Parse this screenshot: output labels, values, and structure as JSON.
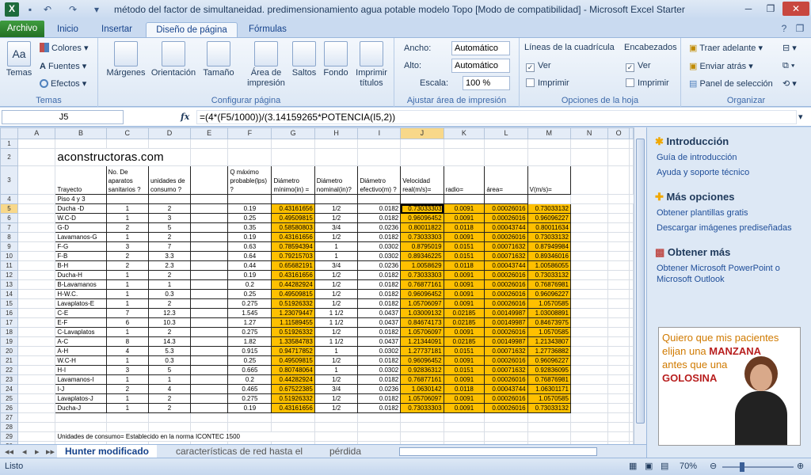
{
  "window": {
    "title": "método del factor de simultaneidad. predimensionamiento agua potable modelo Topo  [Modo de compatibilidad]  -  Microsoft Excel Starter"
  },
  "tabs": [
    "Archivo",
    "Inicio",
    "Insertar",
    "Diseño de página",
    "Fórmulas"
  ],
  "ribbon": {
    "temas": {
      "label": "Temas",
      "colores": "Colores",
      "fuentes": "Fuentes",
      "efectos": "Efectos",
      "group": "Temas"
    },
    "config": {
      "margenes": "Márgenes",
      "orientacion": "Orientación",
      "tamano": "Tamaño",
      "area": "Área de impresión",
      "saltos": "Saltos",
      "fondo": "Fondo",
      "imprimir": "Imprimir títulos",
      "group": "Configurar página"
    },
    "ajustar": {
      "ancho_lbl": "Ancho:",
      "ancho_val": "Automático",
      "alto_lbl": "Alto:",
      "alto_val": "Automático",
      "escala_lbl": "Escala:",
      "escala_val": "100 %",
      "group": "Ajustar área de impresión"
    },
    "opciones": {
      "lineas": "Líneas de la cuadrícula",
      "encabezados": "Encabezados",
      "ver": "Ver",
      "imprimir": "Imprimir",
      "group": "Opciones de la hoja"
    },
    "organizar": {
      "traer": "Traer adelante",
      "enviar": "Enviar atrás",
      "panel": "Panel de selección",
      "group": "Organizar"
    }
  },
  "formula": {
    "namebox": "J5",
    "fx": "fx",
    "text": "=(4*(F5/1000))/(3.14159265*POTENCIA(I5,2))"
  },
  "sheet": {
    "columns": [
      "A",
      "B",
      "C",
      "D",
      "E",
      "F",
      "G",
      "H",
      "I",
      "J",
      "K",
      "L",
      "M",
      "N",
      "O"
    ],
    "logo": "aconstructoras.com",
    "headers": {
      "b": "Trayecto",
      "c": "No. De aparatos sanitarios ?",
      "d": "unidades de consumo ?",
      "f": "Q máximo probable(lps) ?",
      "g": "Diámetro mínimo(in) =",
      "h": "Diámetro nominal(in)?",
      "i": "Diámetro efectivo(m) ?",
      "j": "Velocidad real(m/s)=",
      "k": "radio=",
      "l": "área=",
      "m": "V(m/s)="
    },
    "piso": "Piso 4 y 3",
    "rows": [
      [
        "5",
        "Ducha -D",
        "1",
        "2",
        "0.19",
        "0.43161656",
        "1/2",
        "0.0182",
        "0.73033303",
        "0.0091",
        "0.00026016",
        "0.73033132"
      ],
      [
        "6",
        "W.C-D",
        "1",
        "3",
        "0.25",
        "0.49509815",
        "1/2",
        "0.0182",
        "0.96096452",
        "0.0091",
        "0.00026016",
        "0.96096227"
      ],
      [
        "7",
        "G-D",
        "2",
        "5",
        "0.35",
        "0.58580803",
        "3/4",
        "0.0236",
        "0.80011822",
        "0.0118",
        "0.00043744",
        "0.80011634"
      ],
      [
        "8",
        "Lavamanos-G",
        "1",
        "2",
        "0.19",
        "0.43161656",
        "1/2",
        "0.0182",
        "0.73033303",
        "0.0091",
        "0.00026016",
        "0.73033132"
      ],
      [
        "9",
        "F-G",
        "3",
        "7",
        "0.63",
        "0.78594394",
        "1",
        "0.0302",
        "0.8795019",
        "0.0151",
        "0.00071632",
        "0.87949984"
      ],
      [
        "10",
        "F-B",
        "2",
        "3.3",
        "0.64",
        "0.79215703",
        "1",
        "0.0302",
        "0.89346225",
        "0.0151",
        "0.00071632",
        "0.89346016"
      ],
      [
        "11",
        "B-H",
        "2",
        "2.3",
        "0.44",
        "0.65682191",
        "3/4",
        "0.0236",
        "1.0058629",
        "0.0118",
        "0.00043744",
        "1.00586055"
      ],
      [
        "12",
        "Ducha-H",
        "1",
        "2",
        "0.19",
        "0.43161656",
        "1/2",
        "0.0182",
        "0.73033303",
        "0.0091",
        "0.00026016",
        "0.73033132"
      ],
      [
        "13",
        "B-Lavamanos",
        "1",
        "1",
        "0.2",
        "0.44282924",
        "1/2",
        "0.0182",
        "0.76877161",
        "0.0091",
        "0.00026016",
        "0.76876981"
      ],
      [
        "14",
        "H-W.C.",
        "1",
        "0.3",
        "0.25",
        "0.49509815",
        "1/2",
        "0.0182",
        "0.96096452",
        "0.0091",
        "0.00026016",
        "0.96096227"
      ],
      [
        "15",
        "Lavaplatos-E",
        "1",
        "2",
        "0.275",
        "0.51926332",
        "1/2",
        "0.0182",
        "1.05706097",
        "0.0091",
        "0.00026016",
        "1.0570585"
      ],
      [
        "16",
        "C-E",
        "7",
        "12.3",
        "1.545",
        "1.23079447",
        "1 1/2",
        "0.0437",
        "1.03009132",
        "0.02185",
        "0.00149987",
        "1.03008891"
      ],
      [
        "17",
        "E-F",
        "6",
        "10.3",
        "1.27",
        "1.11589455",
        "1 1/2",
        "0.0437",
        "0.84674173",
        "0.02185",
        "0.00149987",
        "0.84673975"
      ],
      [
        "18",
        "C-Lavaplatos",
        "1",
        "2",
        "0.275",
        "0.51926332",
        "1/2",
        "0.0182",
        "1.05706097",
        "0.0091",
        "0.00026016",
        "1.0570585"
      ],
      [
        "19",
        "A-C",
        "8",
        "14.3",
        "1.82",
        "1.33584783",
        "1 1/2",
        "0.0437",
        "1.21344091",
        "0.02185",
        "0.00149987",
        "1.21343807"
      ],
      [
        "20",
        "A-H",
        "4",
        "5.3",
        "0.915",
        "0.94717852",
        "1",
        "0.0302",
        "1.27737181",
        "0.0151",
        "0.00071632",
        "1.27736882"
      ],
      [
        "21",
        "W.C-H",
        "1",
        "0.3",
        "0.25",
        "0.49509815",
        "1/2",
        "0.0182",
        "0.96096452",
        "0.0091",
        "0.00026016",
        "0.96096227"
      ],
      [
        "22",
        "H-I",
        "3",
        "5",
        "0.665",
        "0.80748064",
        "1",
        "0.0302",
        "0.92836312",
        "0.0151",
        "0.00071632",
        "0.92836095"
      ],
      [
        "23",
        "Lavamanos-I",
        "1",
        "1",
        "0.2",
        "0.44282924",
        "1/2",
        "0.0182",
        "0.76877161",
        "0.0091",
        "0.00026016",
        "0.76876981"
      ],
      [
        "24",
        "I-J",
        "2",
        "4",
        "0.465",
        "0.67522385",
        "3/4",
        "0.0236",
        "1.0630142",
        "0.0118",
        "0.00043744",
        "1.06301171"
      ],
      [
        "25",
        "Lavaplatos-J",
        "1",
        "2",
        "0.275",
        "0.51926332",
        "1/2",
        "0.0182",
        "1.05706097",
        "0.0091",
        "0.00026016",
        "1.0570585"
      ],
      [
        "26",
        "Ducha-J",
        "1",
        "2",
        "0.19",
        "0.43161656",
        "1/2",
        "0.0182",
        "0.73033303",
        "0.0091",
        "0.00026016",
        "0.73033132"
      ]
    ],
    "note": "Unidades de consumo= Establecido en la norma ICONTEC 1500"
  },
  "sheet_tabs": [
    "Hunter modificado",
    "características de red hasta el",
    "pérdida fricc"
  ],
  "status": {
    "ready": "Listo",
    "zoom": "70%"
  },
  "pane": {
    "h1": "Introducción",
    "l1": "Guía de introducción",
    "l2": "Ayuda y soporte técnico",
    "h2": "Más opciones",
    "l3": "Obtener plantillas gratis",
    "l4": "Descargar imágenes prediseñadas",
    "h3": "Obtener más",
    "l5": "Obtener Microsoft PowerPoint o Microsoft Outlook",
    "ad": {
      "line1": "Quiero que mis pacientes",
      "line2": "elijan una",
      "line2b": "MANZANA",
      "line3": "antes que una",
      "line4": "GOLOSINA"
    }
  },
  "colors": {
    "accent": "#ffc000",
    "file_tab": "#2d8a2d",
    "link": "#1f4e99"
  }
}
